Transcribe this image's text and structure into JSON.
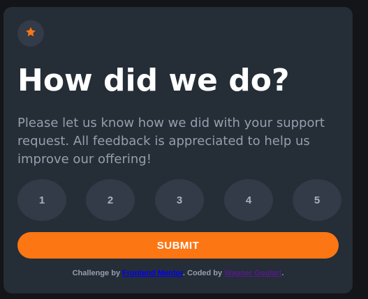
{
  "card": {
    "star_icon": "star-icon",
    "title": "How did we do?",
    "description": "Please let us know how we did with your support request. All feedback is appreciated to help us improve our offering!"
  },
  "ratings": [
    "1",
    "2",
    "3",
    "4",
    "5"
  ],
  "submit_label": "SUBMIT",
  "attribution": {
    "prefix": "Challenge by ",
    "challenge_link": "Frontend Mentor",
    "middle": ". Coded by ",
    "author_link": "Wagner Goulart",
    "suffix": "."
  },
  "colors": {
    "background": "#131518",
    "card": "#252d37",
    "circle": "#323b47",
    "accent": "#fc7614",
    "heading": "#ffffff",
    "muted": "#969fad"
  }
}
